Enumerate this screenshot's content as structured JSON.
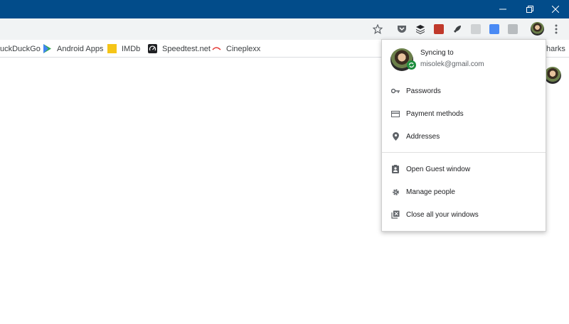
{
  "window": {
    "minimize_icon": "minimize-icon",
    "restore_icon": "restore-icon",
    "close_icon": "close-icon"
  },
  "toolbar": {
    "icons": [
      "star-icon",
      "pocket-icon",
      "layers-icon",
      "red-extension-icon",
      "rocket-icon",
      "contact-extension-icon",
      "translate-icon",
      "extension-icon",
      "profile-avatar",
      "menu-dots-icon"
    ]
  },
  "bookmarks": {
    "items": [
      {
        "label": "uckDuckGo"
      },
      {
        "label": "Android Apps"
      },
      {
        "label": "IMDb"
      },
      {
        "label": "Speedtest.net"
      },
      {
        "label": "Cineplexx"
      }
    ],
    "overflow_label": "harks"
  },
  "profile_menu": {
    "sync_title": "Syncing to",
    "email": "misolek@gmail.com",
    "items": [
      {
        "label": "Passwords",
        "icon": "key-icon"
      },
      {
        "label": "Payment methods",
        "icon": "credit-card-icon"
      },
      {
        "label": "Addresses",
        "icon": "location-pin-icon"
      },
      {
        "label": "Open Guest window",
        "icon": "guest-badge-icon"
      },
      {
        "label": "Manage people",
        "icon": "gear-icon"
      },
      {
        "label": "Close all your windows",
        "icon": "close-windows-icon"
      }
    ]
  },
  "colors": {
    "titlebar": "#024c8a",
    "toolbar": "#f1f3f4",
    "sync_badge": "#1e8e3e"
  }
}
